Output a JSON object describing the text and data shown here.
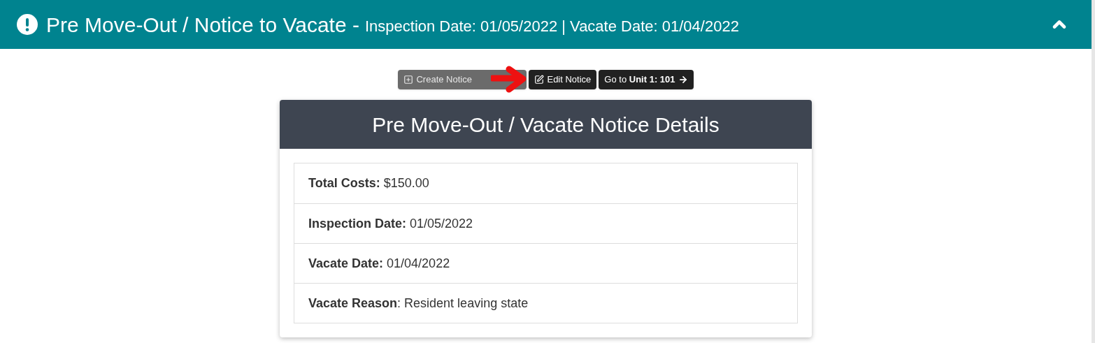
{
  "header": {
    "title": "Pre Move-Out / Notice to Vacate -",
    "subtitle": "Inspection Date: 01/05/2022 | Vacate Date: 01/04/2022",
    "expanded": true
  },
  "buttons": [
    {
      "kind": "create",
      "label": "Create Notice",
      "disabled": true
    },
    {
      "kind": "edit",
      "label": "Edit Notice",
      "disabled": false
    },
    {
      "kind": "goto",
      "label": "Go to **Unit 1: 101**",
      "disabled": false
    }
  ],
  "card": {
    "title": "Pre Move-Out / Vacate Notice Details",
    "rows": [
      {
        "label": "Total Costs:",
        "value": "$150.00"
      },
      {
        "label": "Inspection Date:",
        "value": "01/05/2022"
      },
      {
        "label": "Vacate Date:",
        "value": "01/04/2022"
      },
      {
        "label": "Vacate Reason",
        "value": ": Resident leaving state"
      }
    ]
  }
}
